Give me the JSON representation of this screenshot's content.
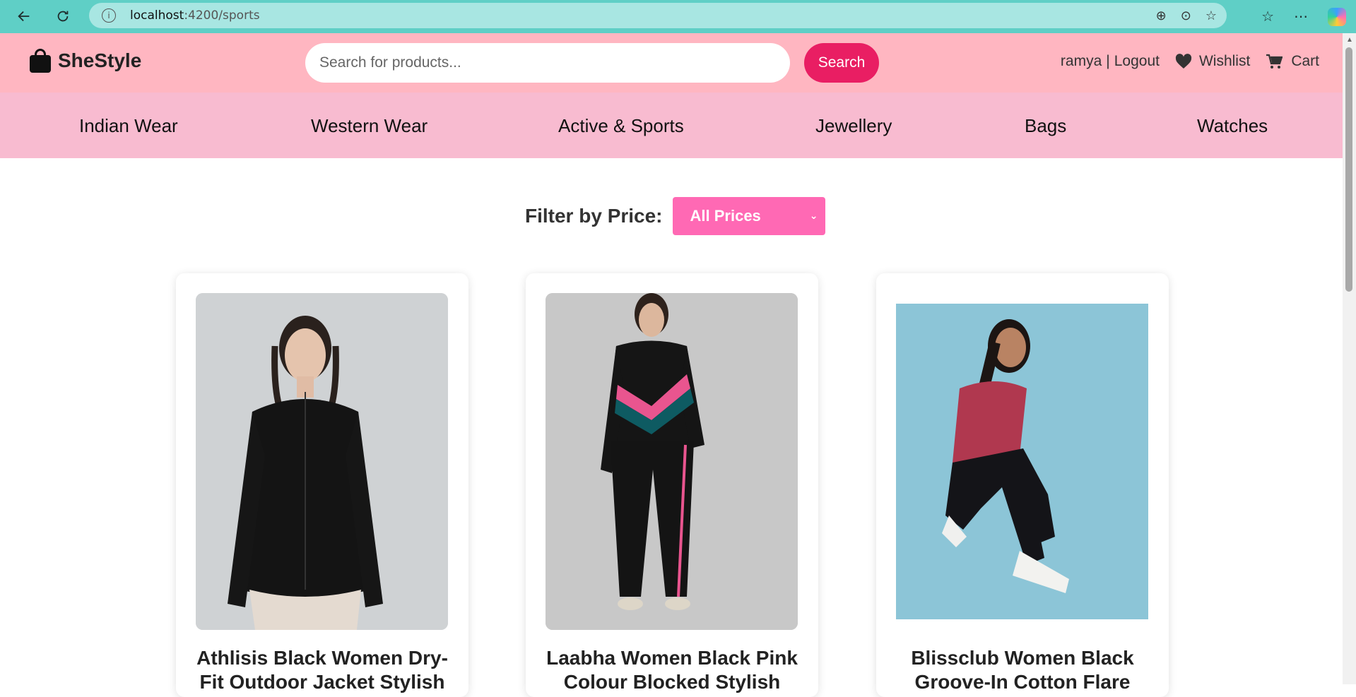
{
  "browser": {
    "url_host": "localhost",
    "url_path": ":4200/sports"
  },
  "header": {
    "logo_text": "SheStyle",
    "search_placeholder": "Search for products...",
    "search_button": "Search",
    "username": "ramya",
    "separator": "|",
    "logout": "Logout",
    "wishlist": "Wishlist",
    "cart": "Cart"
  },
  "categories": [
    "Indian Wear",
    "Western Wear",
    "Active & Sports",
    "Jewellery",
    "Bags",
    "Watches"
  ],
  "filter": {
    "label": "Filter by Price:",
    "selected": "All Prices"
  },
  "products": [
    {
      "title": "Athlisis Black Women Dry-Fit Outdoor Jacket Stylish"
    },
    {
      "title": "Laabha Women Black Pink Colour Blocked Stylish"
    },
    {
      "title": "Blissclub Women Black Groove-In Cotton Flare"
    }
  ],
  "colors": {
    "browser_bar": "#5fcfc6",
    "header_bg": "#ffb6c1",
    "nav_bg": "#f8bbd0",
    "accent": "#e91e63",
    "filter_bg": "#ff69b4"
  }
}
